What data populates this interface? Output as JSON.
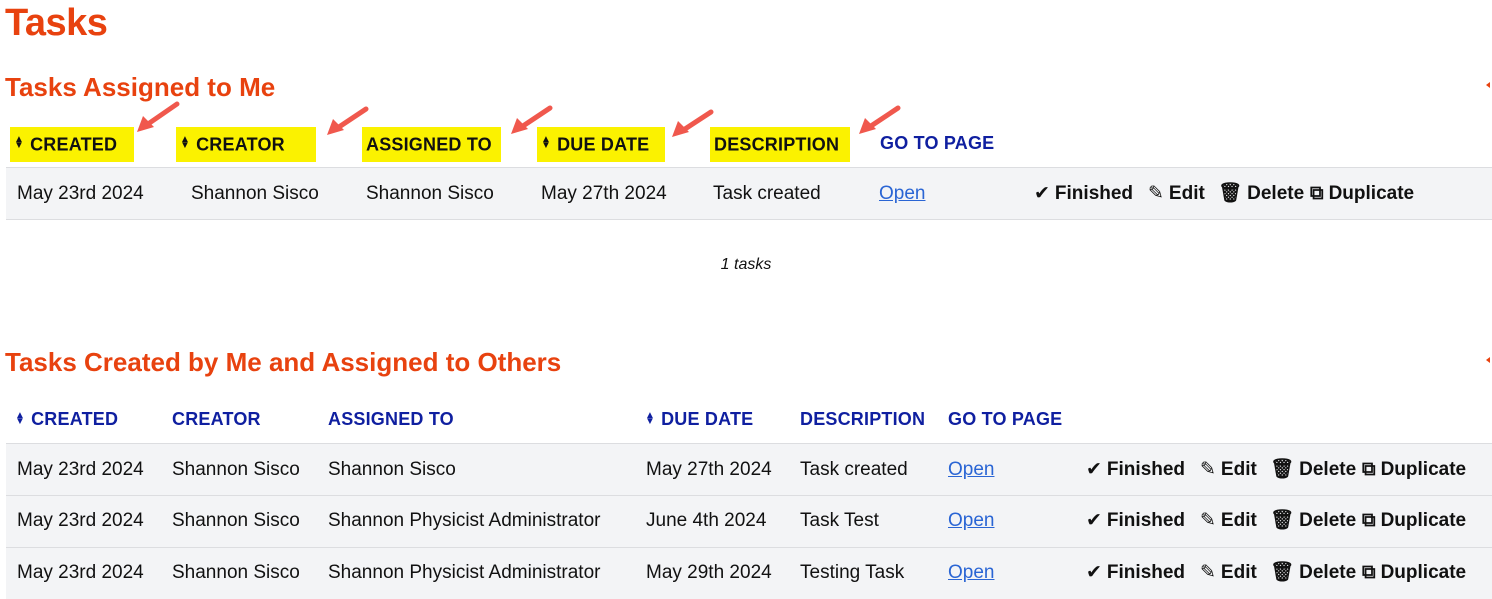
{
  "page": {
    "title": "Tasks"
  },
  "assigned_to_me": {
    "title": "Tasks Assigned to Me",
    "columns": {
      "created": "CREATED",
      "creator": "CREATOR",
      "assigned_to": "ASSIGNED TO",
      "due_date": "DUE DATE",
      "description": "DESCRIPTION",
      "go_to_page": "GO TO PAGE"
    },
    "rows": [
      {
        "created": "May 23rd 2024",
        "creator": "Shannon Sisco",
        "assigned_to": "Shannon Sisco",
        "due_date": "May 27th 2024",
        "description": "Task created",
        "link": "Open"
      }
    ],
    "count": "1 tasks"
  },
  "created_by_me": {
    "title": "Tasks Created by Me and Assigned to Others",
    "columns": {
      "created": "CREATED",
      "creator": "CREATOR",
      "assigned_to": "ASSIGNED TO",
      "due_date": "DUE DATE",
      "description": "DESCRIPTION",
      "go_to_page": "GO TO PAGE"
    },
    "rows": [
      {
        "created": "May 23rd 2024",
        "creator": "Shannon Sisco",
        "assigned_to": "Shannon Sisco",
        "due_date": "May 27th 2024",
        "description": "Task created",
        "link": "Open"
      },
      {
        "created": "May 23rd 2024",
        "creator": "Shannon Sisco",
        "assigned_to": "Shannon Physicist Administrator",
        "due_date": "June 4th 2024",
        "description": "Task Test",
        "link": "Open"
      },
      {
        "created": "May 23rd 2024",
        "creator": "Shannon Sisco",
        "assigned_to": "Shannon Physicist Administrator",
        "due_date": "May 29th 2024",
        "description": "Testing Task",
        "link": "Open"
      }
    ]
  },
  "actions": {
    "finished": "Finished",
    "edit": "Edit",
    "delete": "Delete",
    "duplicate": "Duplicate"
  },
  "icons": {
    "sort": "sort-icon",
    "finished": "check-icon",
    "edit": "pencil-icon",
    "delete": "trash-icon",
    "duplicate": "copy-icon"
  },
  "colors": {
    "heading": "#e8420f",
    "column_header": "#0f1fa0",
    "highlight": "#fbf200",
    "annotation_arrow": "#f0584d",
    "link": "#2a65d4",
    "row_bg": "#f3f4f6"
  }
}
